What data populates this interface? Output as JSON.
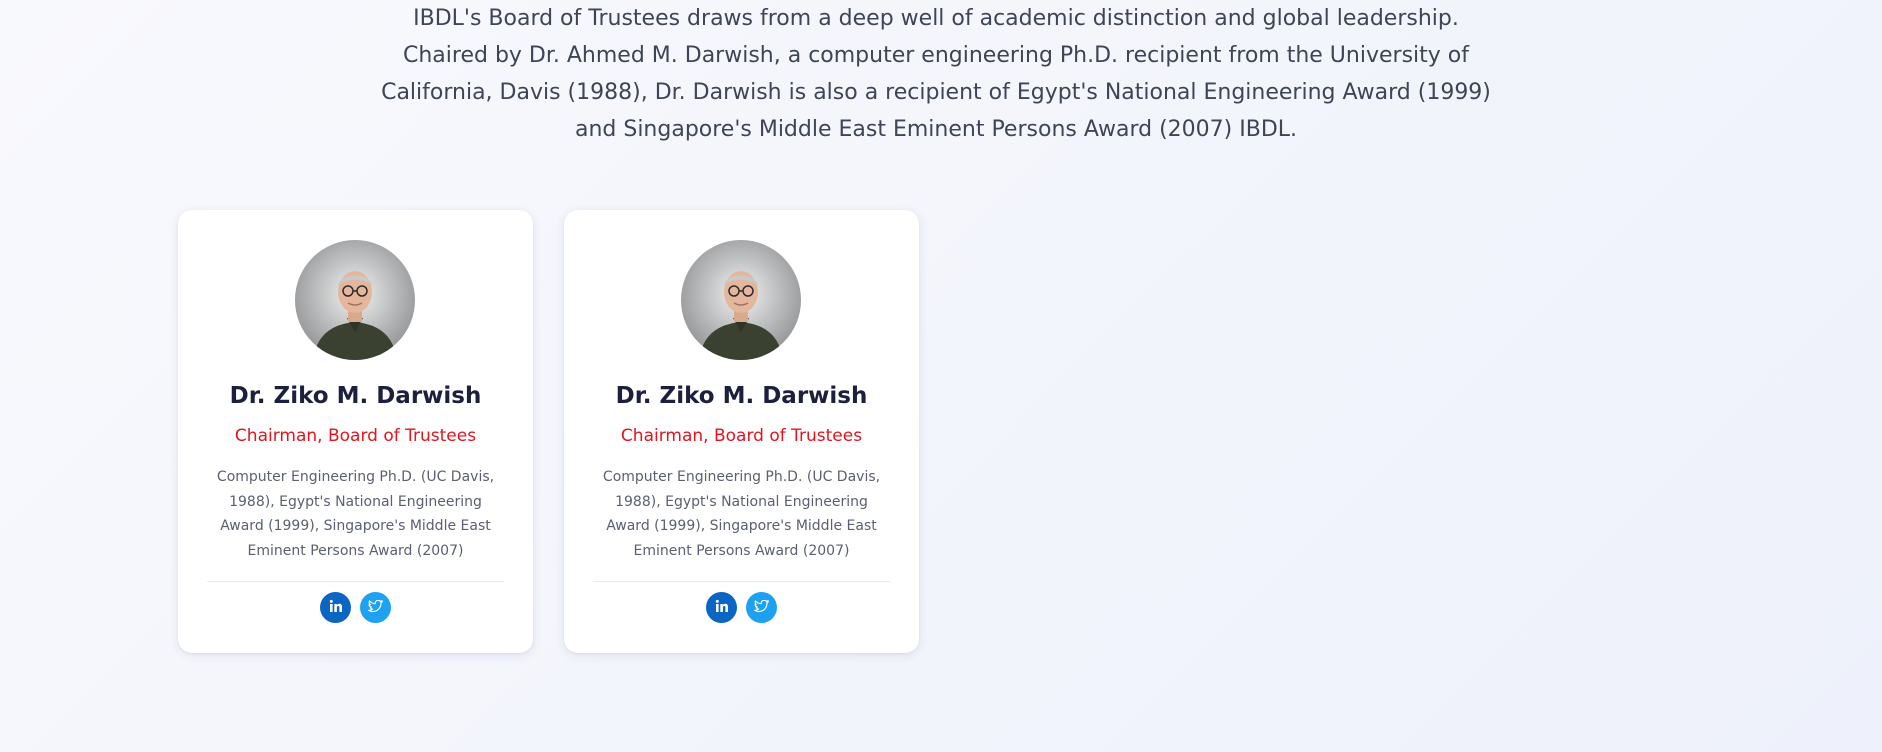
{
  "intro": {
    "text": "IBDL's Board of Trustees draws from a deep well of academic distinction and global leadership. Chaired by Dr. Ahmed M. Darwish, a computer engineering Ph.D. recipient from the University of California, Davis (1988), Dr. Darwish is also a recipient of Egypt's National Engineering Award (1999) and Singapore's Middle East Eminent Persons Award (2007) IBDL."
  },
  "trustees": [
    {
      "name": "Dr. Ziko M. Darwish",
      "role": "Chairman, Board of Trustees",
      "bio": "Computer Engineering Ph.D. (UC Davis, 1988), Egypt's National Engineering Award (1999), Singapore's Middle East Eminent Persons Award (2007)",
      "socials": [
        "linkedin-icon",
        "twitter-icon"
      ]
    },
    {
      "name": "Dr. Ziko M. Darwish",
      "role": "Chairman, Board of Trustees",
      "bio": "Computer Engineering Ph.D. (UC Davis, 1988), Egypt's National Engineering Award (1999), Singapore's Middle East Eminent Persons Award (2007)",
      "socials": [
        "linkedin-icon",
        "twitter-icon"
      ]
    }
  ],
  "colors": {
    "accent_red": "#e3141f",
    "name_navy": "#1c1f3e",
    "linkedin_blue": "#0a66c2",
    "twitter_blue": "#1da1f2"
  }
}
